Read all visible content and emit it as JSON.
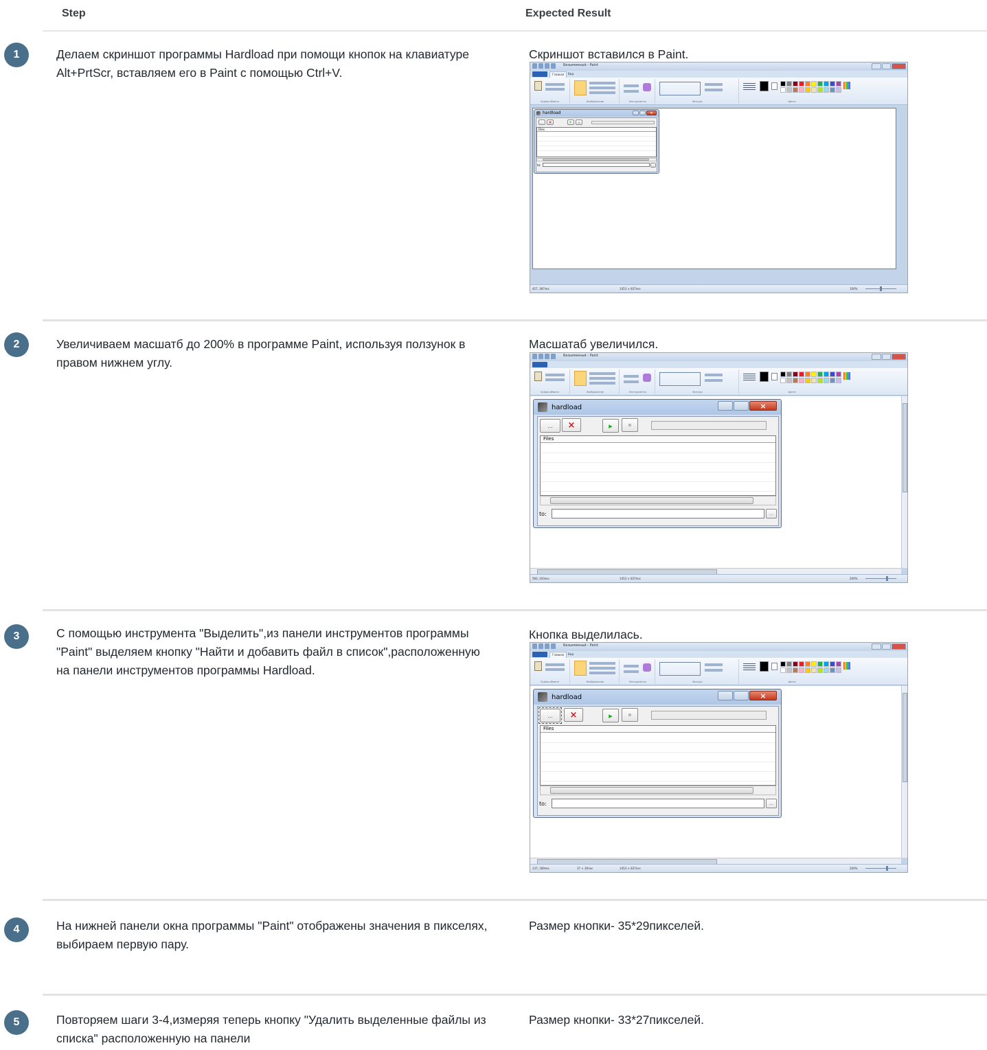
{
  "header": {
    "step_label": "Step",
    "expected_label": "Expected Result"
  },
  "rows": [
    {
      "number": "1",
      "step": "Делаем скриншот программы Hardload при помощи кнопок на клавиатуре Alt+PrtScr, вставляем его в Paint с помощью Ctrl+V.",
      "expected": "Скриншот вставился в Paint."
    },
    {
      "number": "2",
      "step": "Увеличиваем масшатб до 200% в программе Paint, используя ползунок в правом нижнем углу.",
      "expected": "Масшатаб увеличился."
    },
    {
      "number": "3",
      "step": "С помощью инструмента \"Выделить\",из панели инструментов программы \"Paint\" выделяем кнопку \"Найти и добавить файл в список\",расположенную на панели инструментов программы Hardload.",
      "expected": "Кнопка выделилась."
    },
    {
      "number": "4",
      "step": "На нижней панели окна программы \"Paint\" отображены значения в пикселях, выбираем первую пару.",
      "expected": "Размер кнопки- 35*29пикселей."
    },
    {
      "number": "5",
      "step": "Повторяем шаги 3-4,измеряя теперь кнопку \"Удалить выделенные файлы из списка\" расположенную на панели",
      "expected": "Размер кнопки- 33*27пикселей."
    }
  ],
  "paint": {
    "shot1": {
      "title": "Безымянный - Paint",
      "tab_home": "Главная",
      "tab_view": "Вид",
      "window_name": "hardload",
      "list_header": "Files",
      "to_label": "to:",
      "status_coords": "427, 387пкс",
      "status_size": "1453 × 837пкс",
      "status_zoom": "100%"
    },
    "shot2": {
      "title": "Безымянный - Paint",
      "window_name": "hardload",
      "list_header": "Files",
      "to_label": "to:",
      "status_coords": "560, 193пкс",
      "status_size": "1453 × 837пкс",
      "status_zoom": "200%"
    },
    "shot3": {
      "title": "Безымянный - Paint",
      "tab_home": "Главная",
      "tab_view": "Вид",
      "window_name": "hardload",
      "list_header": "Files",
      "to_label": "to:",
      "status_coords": "137, 189пкс",
      "status_selection": "37 × 30пкс",
      "status_size": "1453 × 837пкс",
      "status_zoom": "200%"
    },
    "ribbon": {
      "paste": "Вставить",
      "cut": "Вырезать",
      "copy": "Копировать",
      "select": "Выделить",
      "crop": "Обрезать",
      "resize": "Изменить размер",
      "rotate": "Повернуть",
      "brushes": "Кисти",
      "outline": "Контур",
      "fill": "Заливка",
      "thickness": "Толщина",
      "color1": "Цвет 1",
      "color2": "Цвет 2",
      "edit_colors": "Изменение цветов",
      "group_clipboard": "Буфер обмена",
      "group_image": "Изображение",
      "group_tools": "Инструменты",
      "group_shapes": "Фигуры",
      "group_colors": "Цвета"
    },
    "palette_colors": [
      "#000000",
      "#7f7f7f",
      "#880015",
      "#ed1c24",
      "#ff7f27",
      "#fff200",
      "#22b14c",
      "#00a2e8",
      "#3f48cc",
      "#a349a4",
      "#ffffff",
      "#c3c3c3",
      "#b97a57",
      "#ffaec9",
      "#ffc90e",
      "#efe4b0",
      "#b5e61d",
      "#99d9ea",
      "#7092be",
      "#c8bfe7"
    ]
  }
}
